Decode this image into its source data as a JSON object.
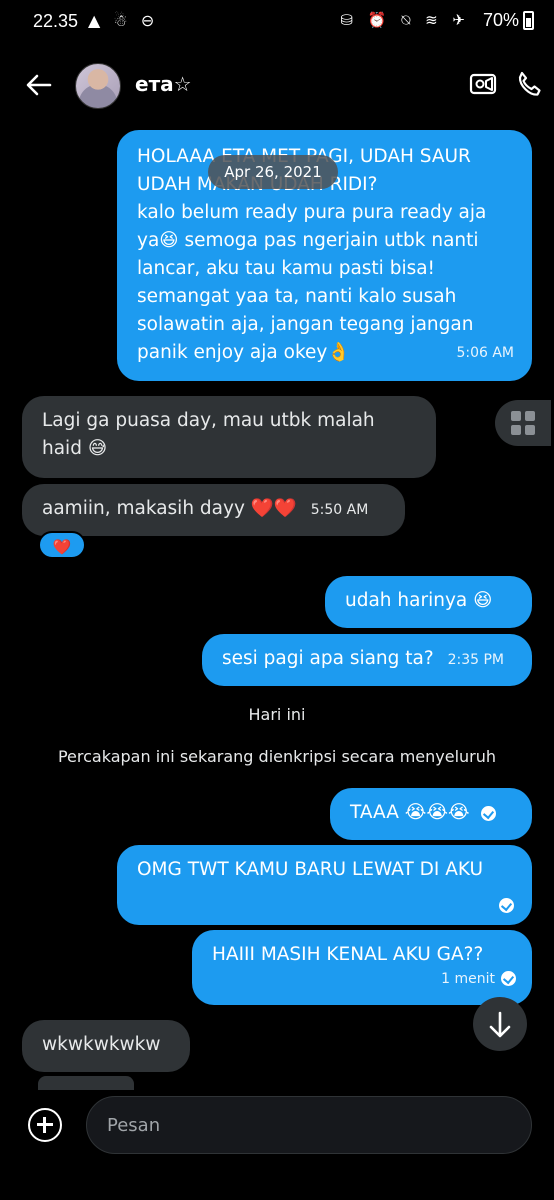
{
  "status": {
    "time": "22.35",
    "left_icons": "▲ ☃ ⊖",
    "right_icons": "⛁ ⏰ ⍉ ≋ ✈",
    "battery": "70%"
  },
  "header": {
    "contact_name": "етa☆",
    "icons": [
      "back-arrow-icon",
      "video-call-icon",
      "phone-icon"
    ]
  },
  "date_pill": "Apr 26, 2021",
  "messages": [
    {
      "dir": "out",
      "text": "HOLAAA ETA MET PAGI, UDAH SAUR UDAH MAKAN UDAH RIDI?\nkalo belum ready pura pura ready aja ya😆 semoga pas ngerjain utbk nanti lancar, aku tau kamu pasti bisa! semangat yaa ta, nanti kalo susah solawatin aja, jangan tegang jangan panik enjoy aja okey👌",
      "time": "5:06 AM"
    },
    {
      "dir": "in",
      "text": "Lagi ga puasa day, mau utbk malah haid 😅",
      "time": ""
    },
    {
      "dir": "in",
      "text": "aamiin, makasih dayy ❤️❤️",
      "time": "5:50 AM"
    },
    {
      "dir": "out",
      "text": "udah harinya 😆",
      "time": ""
    },
    {
      "dir": "out",
      "text": "sesi pagi apa siang ta?",
      "time": "2:35 PM"
    },
    {
      "dir": "out",
      "text": "TAAA 😭😭😭",
      "time": ""
    },
    {
      "dir": "out",
      "text": "OMG TWT KAMU BARU LEWAT DI AKU",
      "time": ""
    },
    {
      "dir": "out",
      "text": "HAIII MASIH KENAL AKU GA??",
      "time": "1 menit"
    },
    {
      "dir": "in",
      "text": "wkwkwkwkw",
      "time": ""
    }
  ],
  "reaction": "❤️",
  "day_label": "Hari ini",
  "encryption_notice": "Percakapan ini sekarang dienkripsi secara menyeluruh",
  "composer": {
    "placeholder": "Pesan"
  },
  "colors": {
    "outgoing": "#1d9bf0",
    "incoming": "#2f3336",
    "background": "#000000"
  }
}
